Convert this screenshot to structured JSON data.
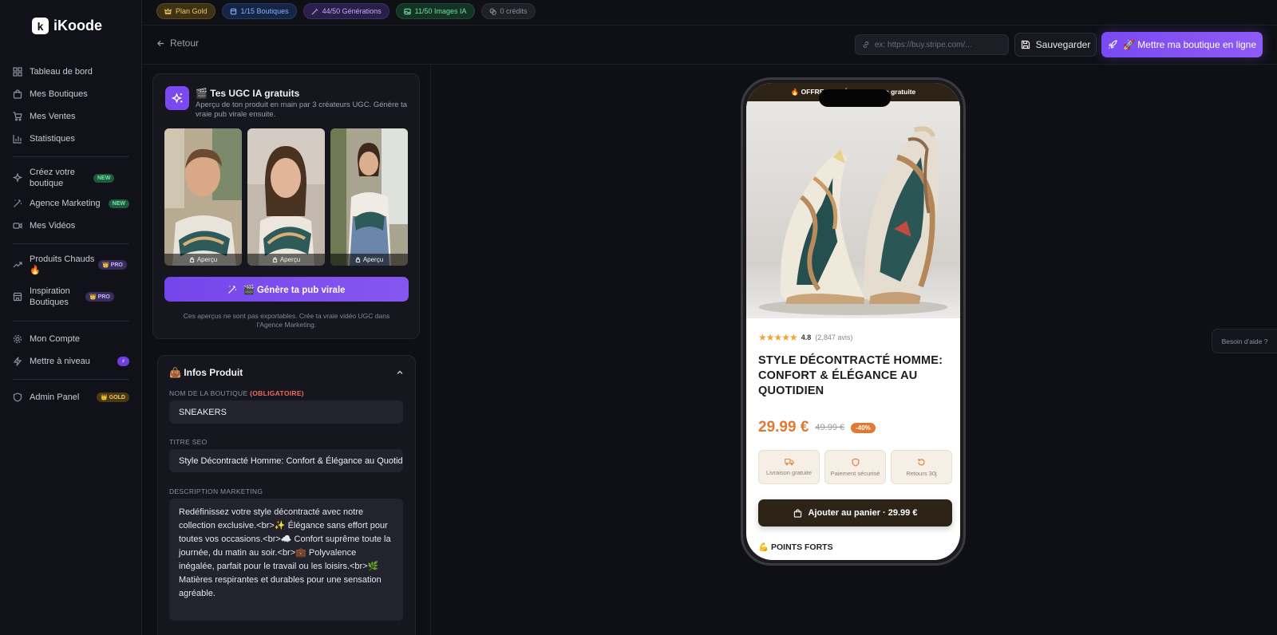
{
  "brand": {
    "name": "iKoode",
    "mark": "k"
  },
  "sidebar": {
    "items": [
      {
        "label": "Tableau de bord"
      },
      {
        "label": "Mes Boutiques"
      },
      {
        "label": "Mes Ventes"
      },
      {
        "label": "Statistiques"
      },
      {
        "label": "Créez votre boutique",
        "badge": "NEW"
      },
      {
        "label": "Agence Marketing",
        "badge": "NEW"
      },
      {
        "label": "Mes Vidéos"
      },
      {
        "label": "Produits Chauds 🔥",
        "badge": "👑 PRO"
      },
      {
        "label": "Inspiration Boutiques",
        "badge": "👑 PRO"
      },
      {
        "label": "Mon Compte"
      },
      {
        "label": "Mettre à niveau",
        "badge": "⚡"
      },
      {
        "label": "Admin Panel",
        "badge": "👑 GOLD"
      }
    ]
  },
  "chips": {
    "plan": "Plan Gold",
    "shops": "1/15 Boutiques",
    "generations": "44/50 Générations",
    "images": "11/50 Images IA",
    "credits": "0 crédits"
  },
  "header": {
    "back": "Retour",
    "url_placeholder": "ex: https://buy.stripe.com/...",
    "save": "Sauvegarder",
    "publish": "🚀 Mettre ma boutique en ligne"
  },
  "ugc": {
    "title": "🎬 Tes UGC IA gratuits",
    "subtitle": "Aperçu de ton produit en main par 3 créateurs UGC. Génère ta vraie pub virale ensuite.",
    "thumb_caption": "Aperçu",
    "button": "🎬 Génère ta pub virale",
    "note": "Ces aperçus ne sont pas exportables. Crée ta vraie vidéo UGC dans l'Agence Marketing."
  },
  "infos": {
    "title": "👜 Infos Produit",
    "shop_name_label": "NOM DE LA BOUTIQUE",
    "required": "(OBLIGATOIRE)",
    "shop_name": "SNEAKERS",
    "seo_label": "TITRE SEO",
    "seo_title": "Style Décontracté Homme: Confort & Élégance au Quotidien",
    "desc_label": "DESCRIPTION MARKETING",
    "description": "Redéfinissez votre style décontracté avec notre collection exclusive.<br>✨ Élégance sans effort pour toutes vos occasions.<br>☁️ Confort suprême toute la journée, du matin au soir.<br>💼 Polyvalence inégalée, parfait pour le travail ou les loisirs.<br>🌿 Matières respirantes et durables pour une sensation agréable."
  },
  "preview": {
    "promo": "🔥 OFFRE LIMITÉE · Livraison gratuite",
    "rating": "4.8",
    "rating_value": 4.8,
    "reviews": "(2,847 avis)",
    "title": "STYLE DÉCONTRACTÉ HOMME: CONFORT & ÉLÉGANCE AU QUOTIDIEN",
    "price": "29.99 €",
    "old_price": "49.99 €",
    "discount": "-40%",
    "features": [
      "Livraison gratuite",
      "Paiement sécurisé",
      "Retours 30j"
    ],
    "cart": "Ajouter au panier · 29.99 €",
    "points": "💪 POINTS FORTS"
  },
  "help": "Besoin d'aide ?",
  "colors": {
    "accent": "#7a4af0",
    "price": "#e07a32",
    "cart": "#2d2316"
  }
}
